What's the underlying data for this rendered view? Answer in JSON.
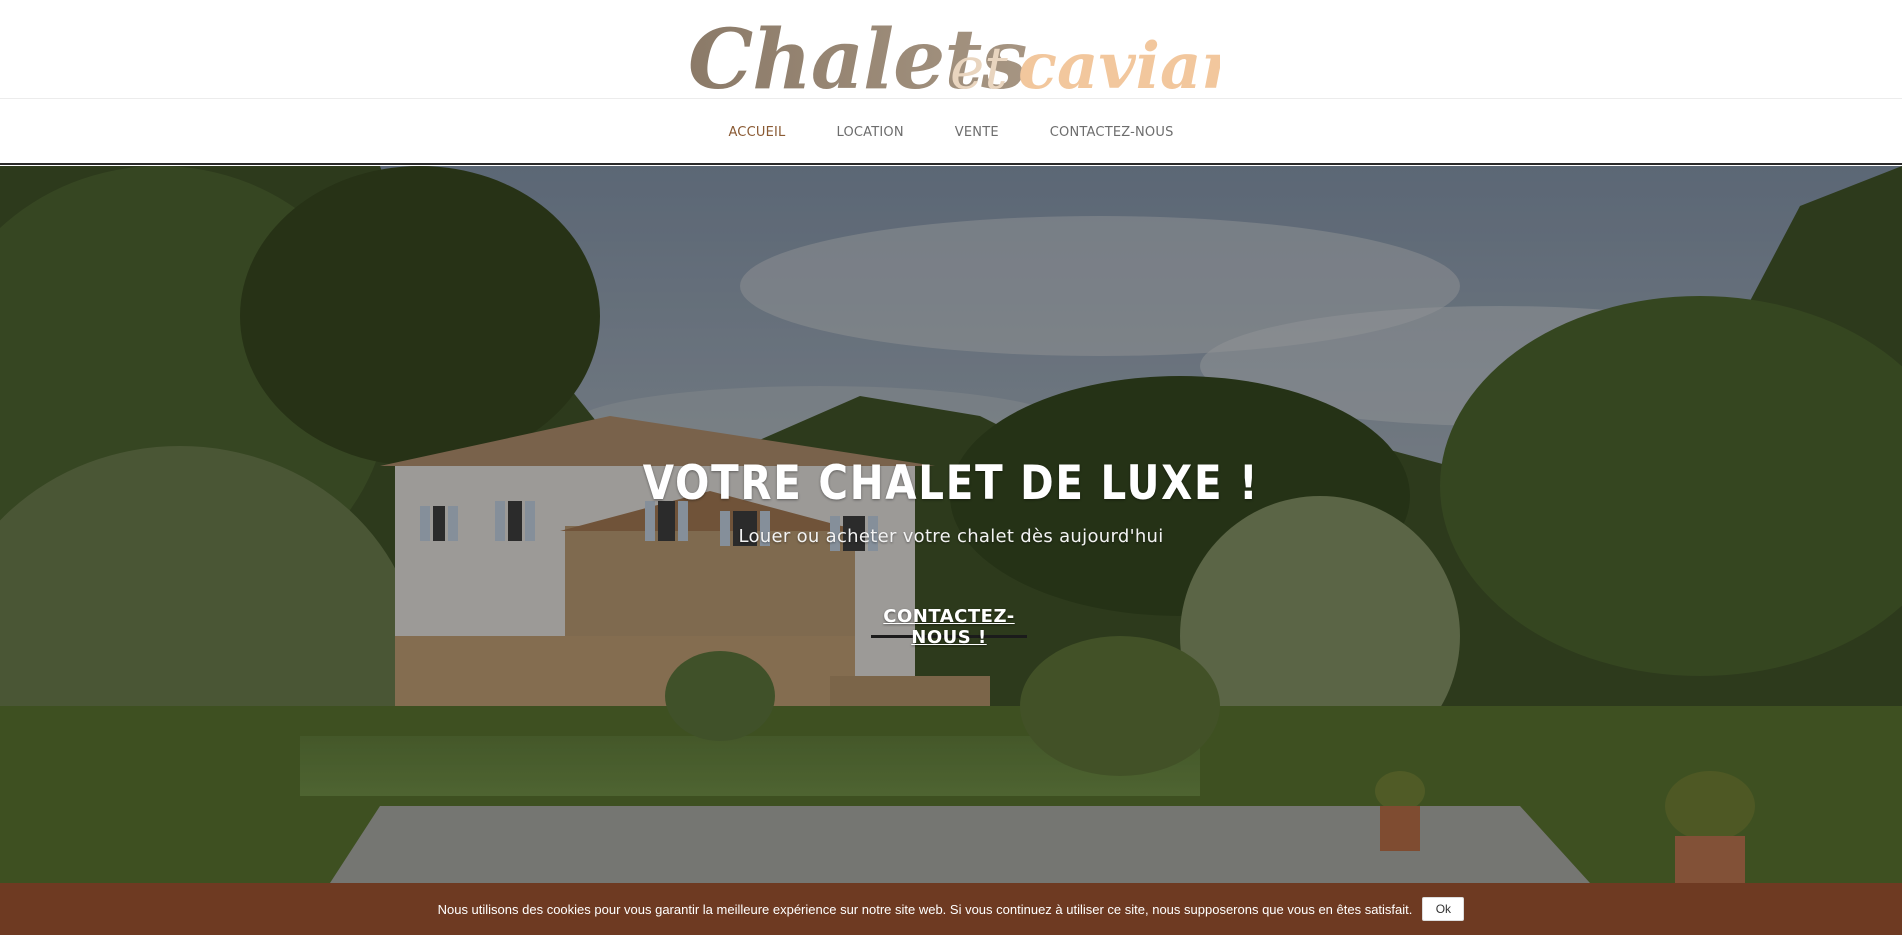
{
  "logo": {
    "word1": "Chalets",
    "word2": "et",
    "word3": "caviar"
  },
  "nav": {
    "items": [
      {
        "label": "ACCUEIL",
        "active": true
      },
      {
        "label": "LOCATION",
        "active": false
      },
      {
        "label": "VENTE",
        "active": false
      },
      {
        "label": "CONTACTEZ-NOUS",
        "active": false
      }
    ]
  },
  "hero": {
    "title": "VOTRE CHALET DE LUXE !",
    "subtitle": "Louer ou acheter votre chalet dès aujourd'hui",
    "cta_label": "CONTACTEZ-NOUS !"
  },
  "cookie": {
    "text": "Nous utilisons des cookies pour vous garantir la meilleure expérience sur notre site web. Si vous continuez à utiliser ce site, nous supposerons que vous en êtes satisfait.",
    "ok_label": "Ok"
  },
  "colors": {
    "logo_brown": "#8d7a66",
    "logo_peach": "#f2c79d",
    "nav_active": "#8a5a33",
    "cookie_bg": "#6e3a22"
  }
}
